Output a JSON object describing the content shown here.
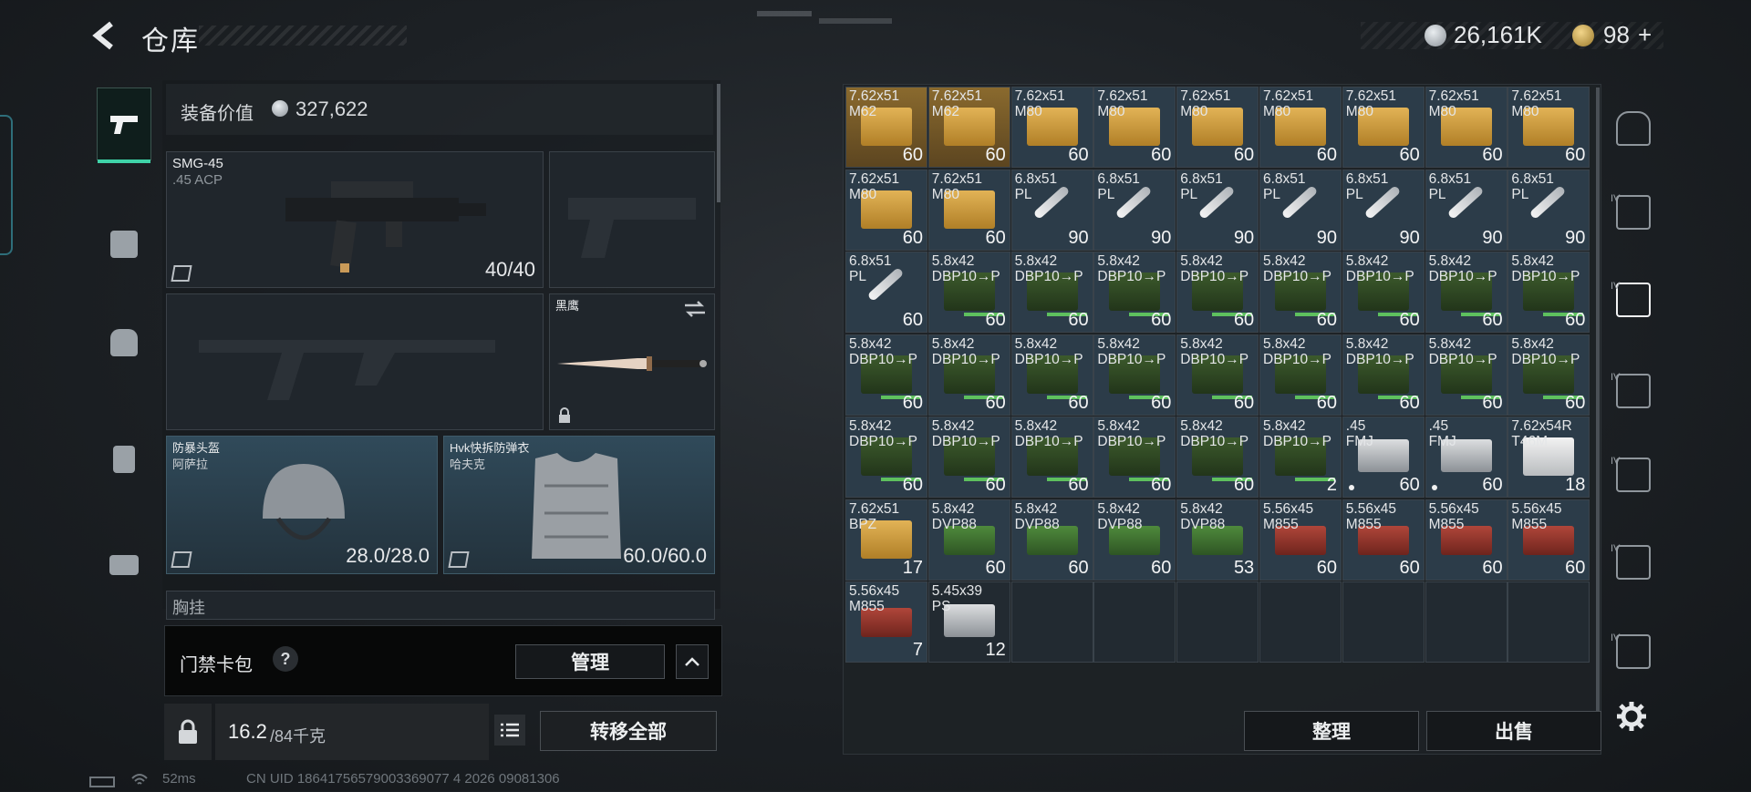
{
  "header": {
    "title": "仓库",
    "silver": "26,161K",
    "gold": "98",
    "gold_add": "+"
  },
  "left_tabs": [
    {
      "name": "weapon-tab",
      "icon": "pistol-icon"
    },
    {
      "name": "armor-tab",
      "icon": "vest-icon"
    },
    {
      "name": "backpack-tab",
      "icon": "backpack-icon"
    },
    {
      "name": "rig-tab",
      "icon": "chest-rig-icon"
    },
    {
      "name": "case-tab",
      "icon": "briefcase-icon"
    }
  ],
  "equipment": {
    "value_label": "装备价值",
    "value": "327,622",
    "primary": {
      "name": "SMG-45",
      "sub": ".45 ACP",
      "durability": "40/40"
    },
    "knife": {
      "name": "黑鹰"
    },
    "helmet": {
      "name": "防暴头盔",
      "sub": "阿萨拉",
      "durability": "28.0/28.0"
    },
    "armor": {
      "name": "Hvk快拆防弹衣",
      "sub": "哈夫克",
      "durability": "60.0/60.0"
    },
    "chest_partial": "胸挂",
    "card_pack": {
      "label": "门禁卡包",
      "help": "?",
      "manage": "管理",
      "collapse": "^"
    },
    "weight": {
      "current": "16.2",
      "max": "/84千克"
    },
    "transfer_all": "转移全部"
  },
  "stash": {
    "cells": [
      {
        "n": "7.62x51\nM62",
        "c": "60",
        "k": "tan",
        "bg": "gold"
      },
      {
        "n": "7.62x51\nM62",
        "c": "60",
        "k": "tan",
        "bg": "gold"
      },
      {
        "n": "7.62x51\nM80",
        "c": "60",
        "k": "tan",
        "bg": "blue"
      },
      {
        "n": "7.62x51\nM80",
        "c": "60",
        "k": "tan",
        "bg": "blue"
      },
      {
        "n": "7.62x51\nM80",
        "c": "60",
        "k": "tan",
        "bg": "blue"
      },
      {
        "n": "7.62x51\nM80",
        "c": "60",
        "k": "tan",
        "bg": "blue"
      },
      {
        "n": "7.62x51\nM80",
        "c": "60",
        "k": "tan",
        "bg": "blue"
      },
      {
        "n": "7.62x51\nM80",
        "c": "60",
        "k": "tan",
        "bg": "blue"
      },
      {
        "n": "7.62x51\nM80",
        "c": "60",
        "k": "tan",
        "bg": "blue"
      },
      {
        "n": "7.62x51\nM80",
        "c": "60",
        "k": "tan",
        "bg": "blue"
      },
      {
        "n": "7.62x51\nM80",
        "c": "60",
        "k": "tan",
        "bg": "blue"
      },
      {
        "n": "6.8x51\nPL",
        "c": "90",
        "k": "bullet",
        "bg": "blue"
      },
      {
        "n": "6.8x51\nPL",
        "c": "90",
        "k": "bullet",
        "bg": "blue"
      },
      {
        "n": "6.8x51\nPL",
        "c": "90",
        "k": "bullet",
        "bg": "blue"
      },
      {
        "n": "6.8x51\nPL",
        "c": "90",
        "k": "bullet",
        "bg": "blue"
      },
      {
        "n": "6.8x51\nPL",
        "c": "90",
        "k": "bullet",
        "bg": "blue"
      },
      {
        "n": "6.8x51\nPL",
        "c": "90",
        "k": "bullet",
        "bg": "blue"
      },
      {
        "n": "6.8x51\nPL",
        "c": "90",
        "k": "bullet",
        "bg": "blue"
      },
      {
        "n": "6.8x51\nPL",
        "c": "60",
        "k": "bullet",
        "bg": "blue"
      },
      {
        "n": "5.8x42\nDBP10→P",
        "c": "60",
        "k": "green",
        "bg": "blue"
      },
      {
        "n": "5.8x42\nDBP10→P",
        "c": "60",
        "k": "green",
        "bg": "blue"
      },
      {
        "n": "5.8x42\nDBP10→P",
        "c": "60",
        "k": "green",
        "bg": "blue"
      },
      {
        "n": "5.8x42\nDBP10→P",
        "c": "60",
        "k": "green",
        "bg": "blue"
      },
      {
        "n": "5.8x42\nDBP10→P",
        "c": "60",
        "k": "green",
        "bg": "blue"
      },
      {
        "n": "5.8x42\nDBP10→P",
        "c": "60",
        "k": "green",
        "bg": "blue"
      },
      {
        "n": "5.8x42\nDBP10→P",
        "c": "60",
        "k": "green",
        "bg": "blue"
      },
      {
        "n": "5.8x42\nDBP10→P",
        "c": "60",
        "k": "green",
        "bg": "blue"
      },
      {
        "n": "5.8x42\nDBP10→P",
        "c": "60",
        "k": "green",
        "bg": "blue"
      },
      {
        "n": "5.8x42\nDBP10→P",
        "c": "60",
        "k": "green",
        "bg": "blue"
      },
      {
        "n": "5.8x42\nDBP10→P",
        "c": "60",
        "k": "green",
        "bg": "blue"
      },
      {
        "n": "5.8x42\nDBP10→P",
        "c": "60",
        "k": "green",
        "bg": "blue"
      },
      {
        "n": "5.8x42\nDBP10→P",
        "c": "60",
        "k": "green",
        "bg": "blue"
      },
      {
        "n": "5.8x42\nDBP10→P",
        "c": "60",
        "k": "green",
        "bg": "blue"
      },
      {
        "n": "5.8x42\nDBP10→P",
        "c": "60",
        "k": "green",
        "bg": "blue"
      },
      {
        "n": "5.8x42\nDBP10→P",
        "c": "60",
        "k": "green",
        "bg": "blue"
      },
      {
        "n": "5.8x42\nDBP10→P",
        "c": "60",
        "k": "green",
        "bg": "blue"
      },
      {
        "n": "5.8x42\nDBP10→P",
        "c": "60",
        "k": "green",
        "bg": "blue"
      },
      {
        "n": "5.8x42\nDBP10→P",
        "c": "60",
        "k": "green",
        "bg": "blue"
      },
      {
        "n": "5.8x42\nDBP10→P",
        "c": "60",
        "k": "green",
        "bg": "blue"
      },
      {
        "n": "5.8x42\nDBP10→P",
        "c": "60",
        "k": "green",
        "bg": "blue"
      },
      {
        "n": "5.8x42\nDBP10→P",
        "c": "60",
        "k": "green",
        "bg": "blue"
      },
      {
        "n": "5.8x42\nDBP10→P",
        "c": "2",
        "k": "green",
        "bg": "blue"
      },
      {
        "n": ".45\nFMJ",
        "c": "60",
        "k": "silver",
        "bg": "blue",
        "dot": true
      },
      {
        "n": ".45\nFMJ",
        "c": "60",
        "k": "silver",
        "bg": "blue",
        "dot": true
      },
      {
        "n": "7.62x54R\nT46M",
        "c": "18",
        "k": "white",
        "bg": "blue"
      },
      {
        "n": "7.62x51\nBPZ",
        "c": "17",
        "k": "tan",
        "bg": "blue"
      },
      {
        "n": "5.8x42\nDVP88",
        "c": "60",
        "k": "greenflat",
        "bg": "blue"
      },
      {
        "n": "5.8x42\nDVP88",
        "c": "60",
        "k": "greenflat",
        "bg": "blue"
      },
      {
        "n": "5.8x42\nDVP88",
        "c": "60",
        "k": "greenflat",
        "bg": "blue"
      },
      {
        "n": "5.8x42\nDVP88",
        "c": "53",
        "k": "greenflat",
        "bg": "blue"
      },
      {
        "n": "5.56x45\nM855",
        "c": "60",
        "k": "redflat",
        "bg": "blue"
      },
      {
        "n": "5.56x45\nM855",
        "c": "60",
        "k": "redflat",
        "bg": "blue"
      },
      {
        "n": "5.56x45\nM855",
        "c": "60",
        "k": "redflat",
        "bg": "blue"
      },
      {
        "n": "5.56x45\nM855",
        "c": "60",
        "k": "redflat",
        "bg": "blue"
      },
      {
        "n": "5.56x45\nM855",
        "c": "7",
        "k": "redflat",
        "bg": "blue"
      },
      {
        "n": "5.45x39\nPS",
        "c": "12",
        "k": "silver",
        "bg": "dark"
      }
    ],
    "sort_button": "整理",
    "sell_button": "出售"
  },
  "right_rail": {
    "labels": [
      "IV",
      "IV",
      "IV",
      "IV",
      "IV",
      "IV"
    ]
  },
  "status": {
    "ping": "52ms",
    "uid": "CN UID 18641756579003369077 4 2026 09081306"
  }
}
